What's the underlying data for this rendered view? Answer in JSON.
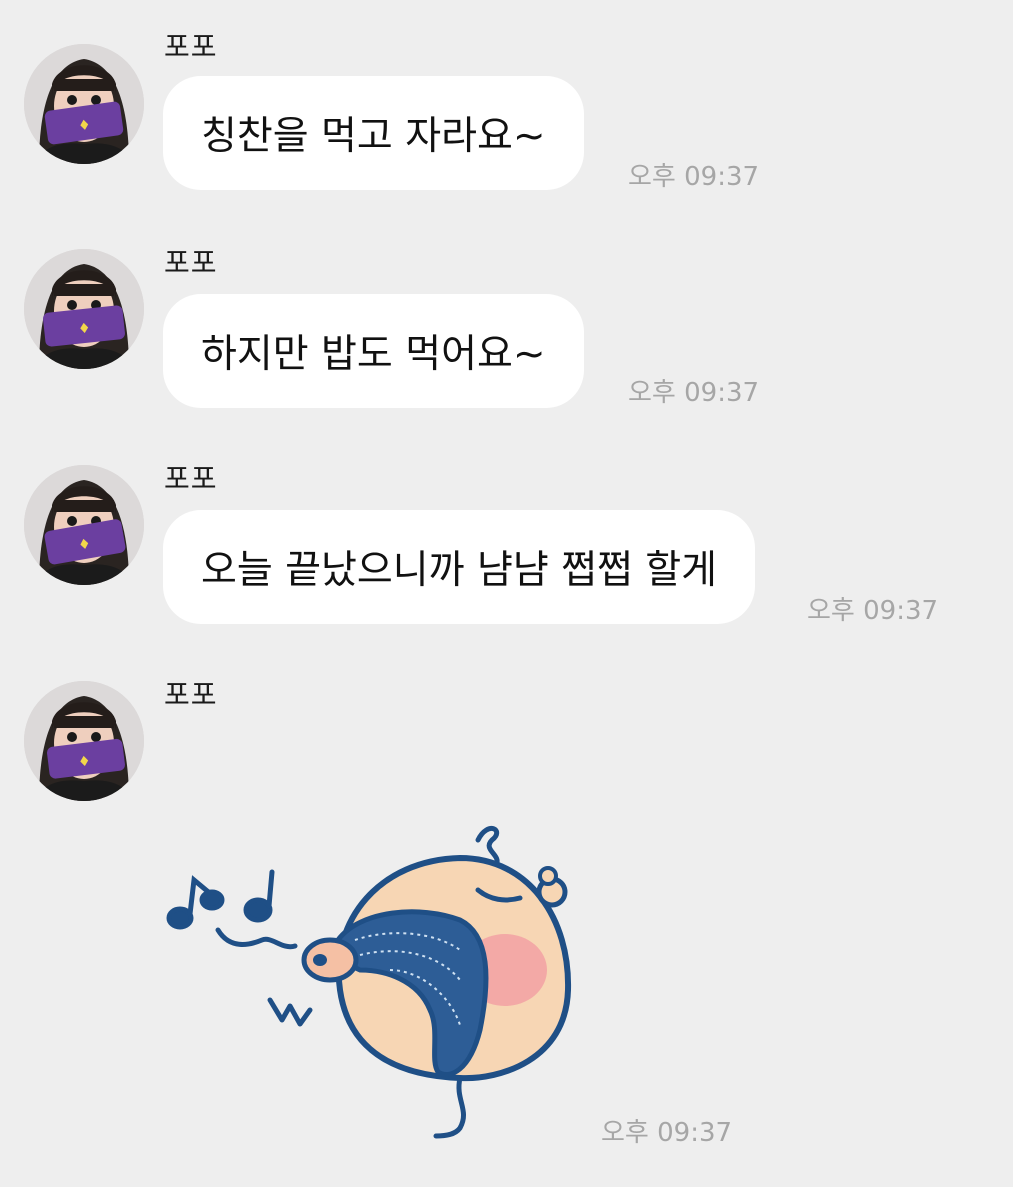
{
  "chat": {
    "messages": [
      {
        "sender": "포포",
        "text": "칭찬을 먹고 자라요~",
        "time": "오후 09:37"
      },
      {
        "sender": "포포",
        "text": "하지만 밥도 먹어요~",
        "time": "오후 09:37"
      },
      {
        "sender": "포포",
        "text": "오늘 끝났으니까 냠냠 쩝쩝 할게",
        "time": "오후 09:37"
      },
      {
        "sender": "포포",
        "sticker": "humming-blob-sticker",
        "time": "오후 09:37"
      }
    ]
  },
  "colors": {
    "background": "#eeeeee",
    "bubble": "#ffffff",
    "timestamp": "#a6a6a6",
    "sticker_outline": "#1f4f86",
    "sticker_body": "#f7d6b4",
    "sticker_cheek": "#f3a9a6"
  }
}
